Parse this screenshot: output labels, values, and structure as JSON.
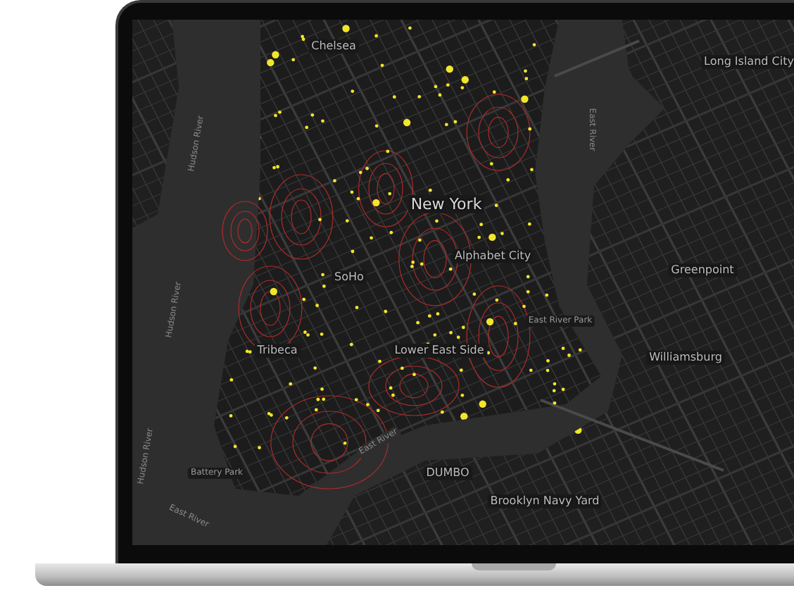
{
  "map": {
    "labels": [
      {
        "text": "Chelsea",
        "kind": "neighborhood"
      },
      {
        "text": "New York",
        "kind": "city"
      },
      {
        "text": "Long Island City",
        "kind": "neighborhood"
      },
      {
        "text": "Greenpoint",
        "kind": "neighborhood"
      },
      {
        "text": "Williamsburg",
        "kind": "neighborhood"
      },
      {
        "text": "SoHo",
        "kind": "neighborhood"
      },
      {
        "text": "Tribeca",
        "kind": "neighborhood"
      },
      {
        "text": "Lower East Side",
        "kind": "neighborhood"
      },
      {
        "text": "Alphabet City",
        "kind": "neighborhood"
      },
      {
        "text": "DUMBO",
        "kind": "neighborhood"
      },
      {
        "text": "Brooklyn Navy Yard",
        "kind": "neighborhood"
      },
      {
        "text": "East River",
        "kind": "water"
      },
      {
        "text": "East River",
        "kind": "water"
      },
      {
        "text": "East River",
        "kind": "water"
      },
      {
        "text": "Hudson River",
        "kind": "water"
      },
      {
        "text": "Hudson River",
        "kind": "water"
      },
      {
        "text": "Hudson River",
        "kind": "water"
      },
      {
        "text": "Battery Park",
        "kind": "place"
      },
      {
        "text": "East River Park",
        "kind": "place"
      }
    ]
  }
}
